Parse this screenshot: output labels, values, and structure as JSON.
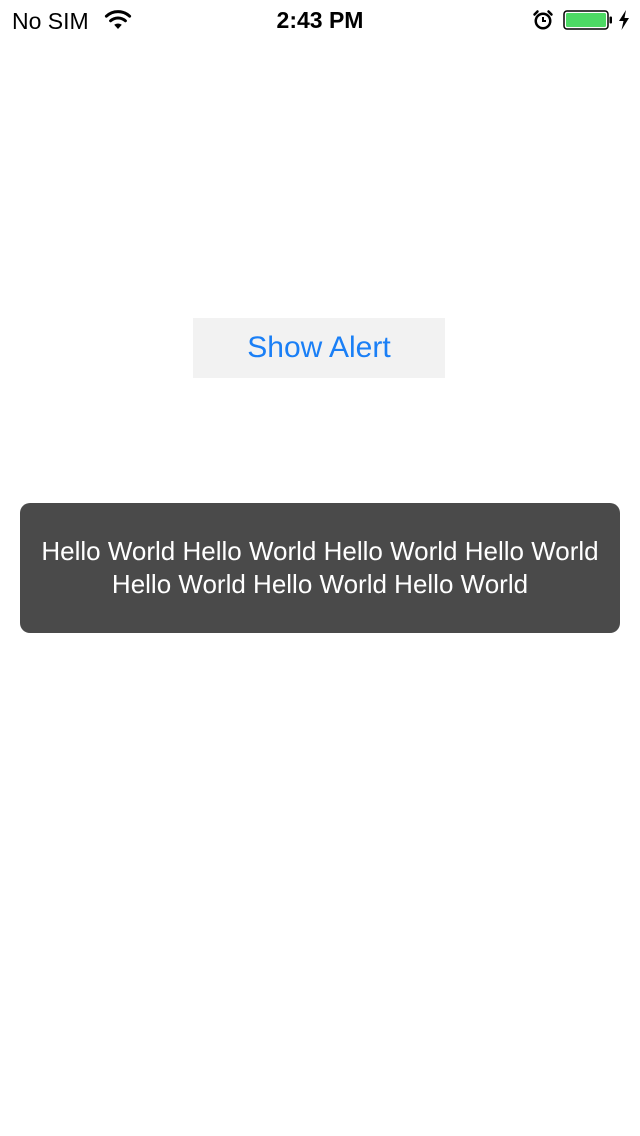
{
  "status_bar": {
    "carrier": "No SIM",
    "time": "2:43 PM",
    "battery_level": 1.0,
    "charging": true,
    "icons": [
      "wifi-icon",
      "alarm-icon",
      "battery-icon",
      "charging-bolt-icon"
    ]
  },
  "main": {
    "show_alert_label": "Show Alert"
  },
  "toast": {
    "message": "Hello World Hello World Hello World Hello World Hello World Hello World Hello World"
  },
  "colors": {
    "accent": "#1a7ff6",
    "button_bg": "#f2f2f2",
    "toast_bg": "#4a4a4a",
    "battery_fill": "#4cd964"
  }
}
